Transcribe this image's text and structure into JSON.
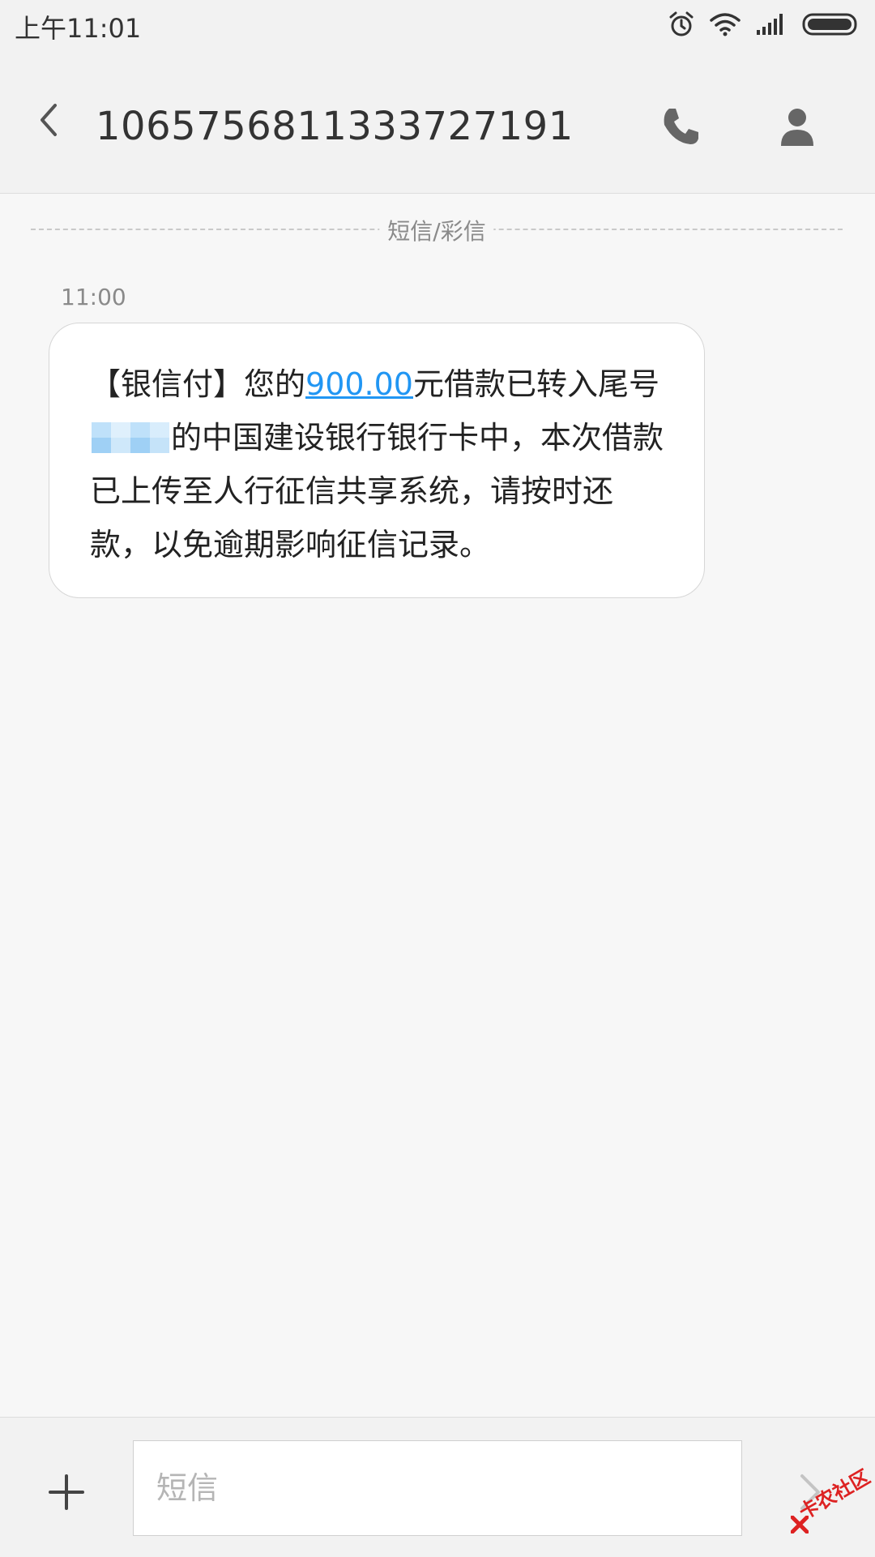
{
  "status_bar": {
    "time": "上午11:01",
    "icons": [
      "alarm-icon",
      "wifi-icon",
      "signal-icon",
      "battery-icon"
    ]
  },
  "header": {
    "contact_number": "1065756811333727191",
    "icons": [
      "back-arrow-icon",
      "phone-icon",
      "person-icon"
    ]
  },
  "conversation": {
    "divider_label": "短信/彩信",
    "messages": [
      {
        "time": "11:00",
        "text_before_amount": "【银信付】您的",
        "amount": "900.00",
        "text_after_amount": "元借款已转入尾号",
        "masked_card_digits": "",
        "text_rest": "的中国建设银行银行卡中，本次借款已上传至人行征信共享系统，请按时还款，以免逾期影响征信记录。"
      }
    ]
  },
  "compose": {
    "placeholder": "短信",
    "value": "",
    "icons": [
      "plus-icon",
      "send-chevron-icon"
    ]
  },
  "watermark": {
    "text": "卡农社区"
  },
  "colors": {
    "background": "#f7f7f7",
    "bars": "#f2f2f2",
    "link": "#2196f3",
    "watermark": "#dd2222"
  }
}
